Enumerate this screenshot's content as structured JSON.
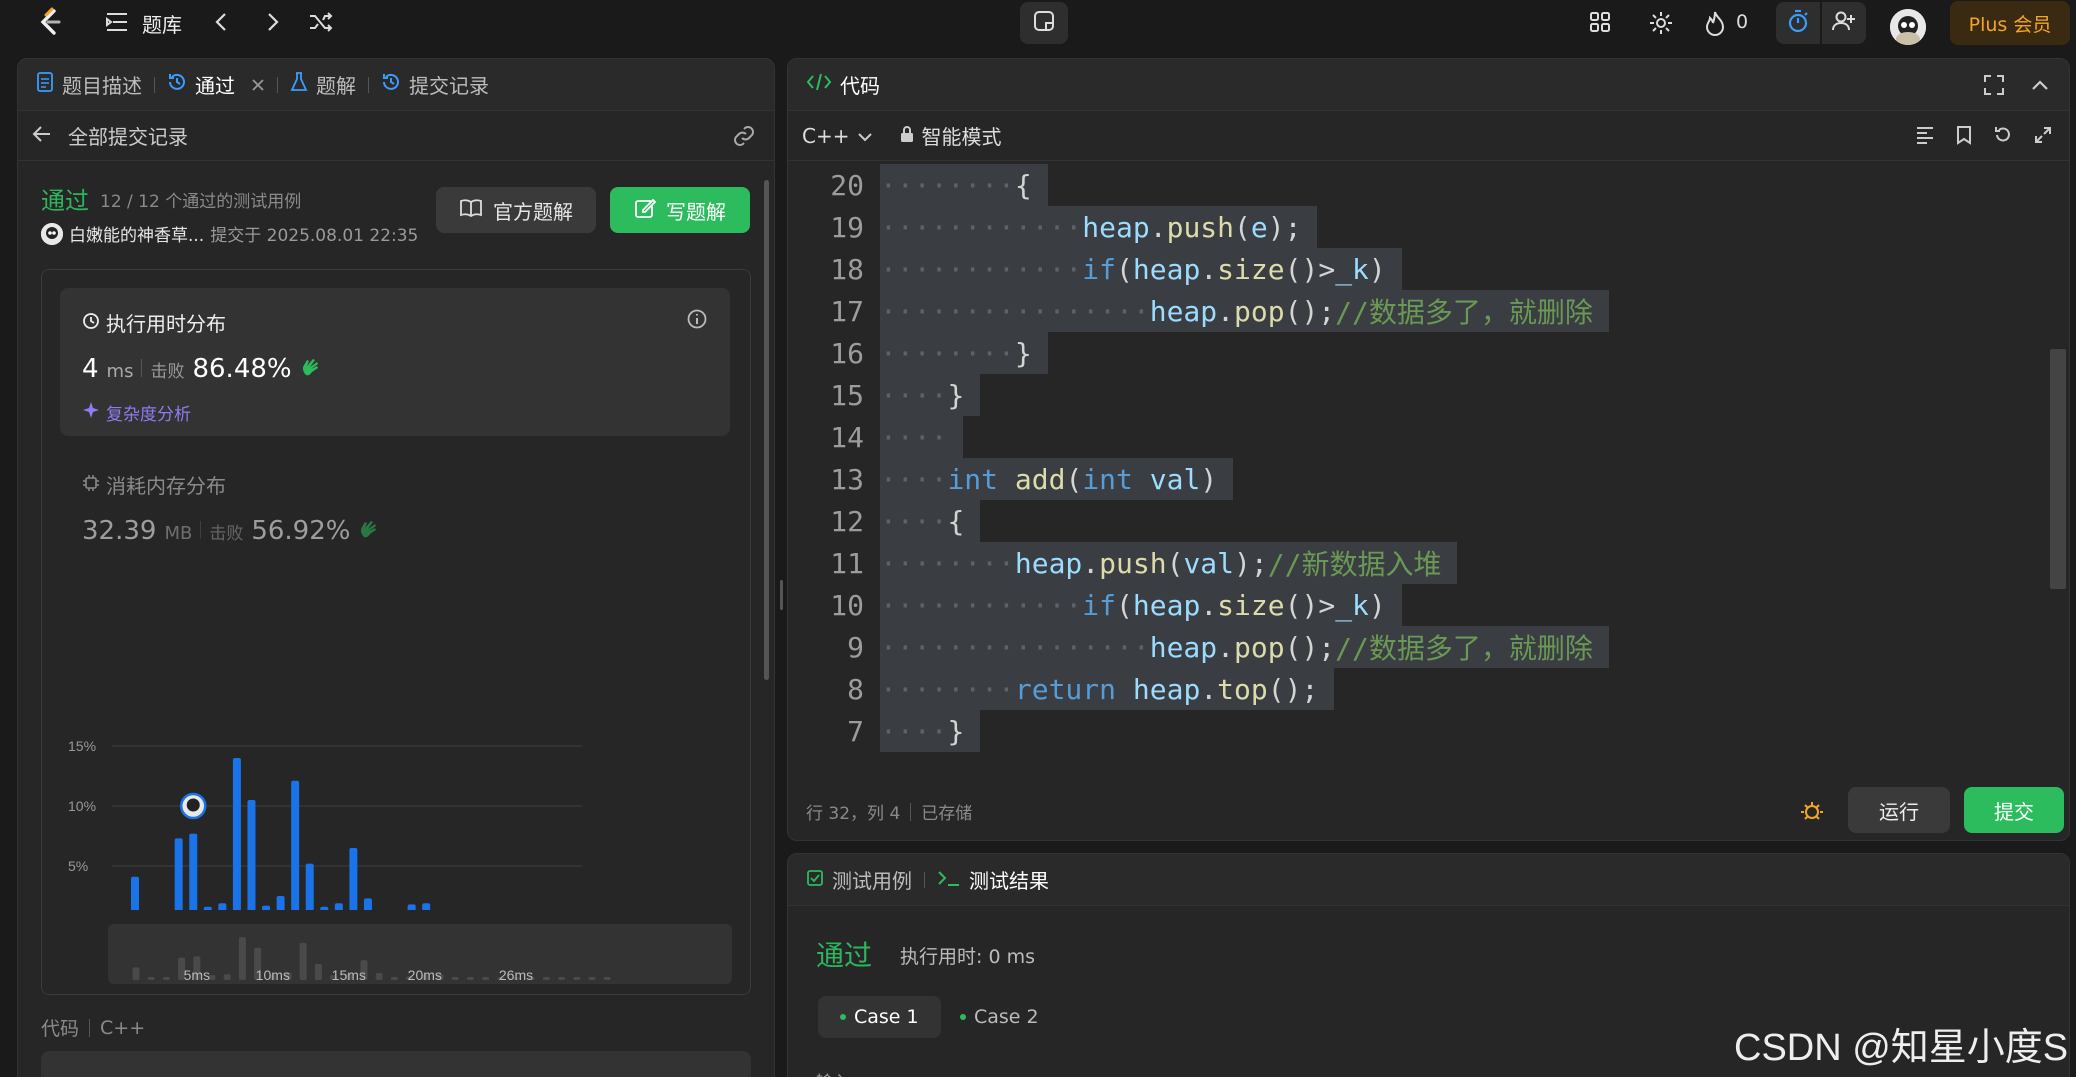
{
  "nav": {
    "title": "题库",
    "fire_count": "0",
    "plus_label": "Plus 会员"
  },
  "left": {
    "tabs": [
      {
        "label": "题目描述"
      },
      {
        "label": "通过"
      },
      {
        "label": "题解"
      },
      {
        "label": "提交记录"
      }
    ],
    "back_label": "全部提交记录",
    "status": "通过",
    "testcases": "12 / 12 个通过的测试用例",
    "user": "白嫩能的神香草...",
    "submitted": "提交于 2025.08.01 22:35",
    "btn_official": "官方题解",
    "btn_write": "写题解",
    "runtime": {
      "title": "执行用时分布",
      "value": "4",
      "unit": "ms",
      "beat_label": "击败",
      "beat_pct": "86.48%",
      "complexity": "复杂度分析"
    },
    "memory": {
      "title": "消耗内存分布",
      "value": "32.39",
      "unit": "MB",
      "beat_label": "击败",
      "beat_pct": "56.92%"
    },
    "code_label": "代码",
    "code_lang": "C++"
  },
  "chart_data": {
    "type": "bar",
    "title": "",
    "xlabel": "",
    "ylabel": "",
    "ylim": [
      0,
      15
    ],
    "y_ticks": [
      "15%",
      "10%",
      "5%",
      "0%"
    ],
    "x_ticks": [
      "5ms",
      "10ms",
      "15ms",
      "20ms",
      "26ms"
    ],
    "values": [
      4.1,
      0.6,
      0.8,
      7.3,
      7.7,
      1.6,
      1.9,
      14.0,
      10.5,
      1.7,
      2.5,
      12.1,
      5.2,
      1.6,
      1.9,
      6.5,
      2.3,
      0.7,
      1.2,
      1.8,
      1.9,
      0.4,
      0.6,
      0.5,
      0.5,
      0.4,
      0.4,
      0.4,
      0.4,
      0.4,
      0.4,
      0.4
    ],
    "highlight_index": 4,
    "mini_x_ticks": [
      "5ms",
      "10ms",
      "15ms",
      "20ms",
      "26ms"
    ]
  },
  "editor": {
    "tab_label": "代码",
    "lang": "C++",
    "mode": "智能模式",
    "lines": [
      {
        "n": "20",
        "indent": 8,
        "tokens": [
          {
            "t": "{",
            "c": "pu"
          }
        ]
      },
      {
        "n": "19",
        "indent": 12,
        "tokens": [
          {
            "t": "heap",
            "c": "vr"
          },
          {
            "t": ".",
            "c": "pu"
          },
          {
            "t": "push",
            "c": "fn"
          },
          {
            "t": "(",
            "c": "pu"
          },
          {
            "t": "e",
            "c": "vr"
          },
          {
            "t": ");",
            "c": "pu"
          }
        ]
      },
      {
        "n": "18",
        "indent": 12,
        "tokens": [
          {
            "t": "if",
            "c": "kw"
          },
          {
            "t": "(",
            "c": "pu"
          },
          {
            "t": "heap",
            "c": "vr"
          },
          {
            "t": ".",
            "c": "pu"
          },
          {
            "t": "size",
            "c": "fn"
          },
          {
            "t": "()>",
            "c": "pu"
          },
          {
            "t": "_k",
            "c": "vr"
          },
          {
            "t": ")",
            "c": "pu"
          }
        ]
      },
      {
        "n": "17",
        "indent": 16,
        "tokens": [
          {
            "t": "heap",
            "c": "vr"
          },
          {
            "t": ".",
            "c": "pu"
          },
          {
            "t": "pop",
            "c": "fn"
          },
          {
            "t": "();",
            "c": "pu"
          },
          {
            "t": "//数据多了，就删除",
            "c": "cm"
          }
        ]
      },
      {
        "n": "16",
        "indent": 8,
        "tokens": [
          {
            "t": "}",
            "c": "pu"
          }
        ]
      },
      {
        "n": "15",
        "indent": 4,
        "tokens": [
          {
            "t": "}",
            "c": "pu"
          }
        ]
      },
      {
        "n": "14",
        "indent": 4,
        "tokens": []
      },
      {
        "n": "13",
        "indent": 4,
        "tokens": [
          {
            "t": "int",
            "c": "kw"
          },
          {
            "t": " ",
            "c": "pu"
          },
          {
            "t": "add",
            "c": "fn"
          },
          {
            "t": "(",
            "c": "pu"
          },
          {
            "t": "int",
            "c": "kw"
          },
          {
            "t": " ",
            "c": "pu"
          },
          {
            "t": "val",
            "c": "vr"
          },
          {
            "t": ")",
            "c": "pu"
          }
        ]
      },
      {
        "n": "12",
        "indent": 4,
        "tokens": [
          {
            "t": "{",
            "c": "pu"
          }
        ]
      },
      {
        "n": "11",
        "indent": 8,
        "tokens": [
          {
            "t": "heap",
            "c": "vr"
          },
          {
            "t": ".",
            "c": "pu"
          },
          {
            "t": "push",
            "c": "fn"
          },
          {
            "t": "(",
            "c": "pu"
          },
          {
            "t": "val",
            "c": "vr"
          },
          {
            "t": ");",
            "c": "pu"
          },
          {
            "t": "//新数据入堆",
            "c": "cm"
          }
        ]
      },
      {
        "n": "10",
        "indent": 12,
        "tokens": [
          {
            "t": "if",
            "c": "kw"
          },
          {
            "t": "(",
            "c": "pu"
          },
          {
            "t": "heap",
            "c": "vr"
          },
          {
            "t": ".",
            "c": "pu"
          },
          {
            "t": "size",
            "c": "fn"
          },
          {
            "t": "()>",
            "c": "pu"
          },
          {
            "t": "_k",
            "c": "vr"
          },
          {
            "t": ")",
            "c": "pu"
          }
        ]
      },
      {
        "n": "9",
        "indent": 16,
        "tokens": [
          {
            "t": "heap",
            "c": "vr"
          },
          {
            "t": ".",
            "c": "pu"
          },
          {
            "t": "pop",
            "c": "fn"
          },
          {
            "t": "();",
            "c": "pu"
          },
          {
            "t": "//数据多了，就删除",
            "c": "cm"
          }
        ]
      },
      {
        "n": "8",
        "indent": 8,
        "tokens": [
          {
            "t": "return",
            "c": "kw"
          },
          {
            "t": " ",
            "c": "pu"
          },
          {
            "t": "heap",
            "c": "vr"
          },
          {
            "t": ".",
            "c": "pu"
          },
          {
            "t": "top",
            "c": "fn"
          },
          {
            "t": "();",
            "c": "pu"
          }
        ]
      },
      {
        "n": "7",
        "indent": 4,
        "tokens": [
          {
            "t": "}",
            "c": "pu"
          }
        ]
      }
    ],
    "status_pos": "行 32，列 4",
    "status_saved": "已存储",
    "run_label": "运行",
    "submit_label": "提交"
  },
  "bottom": {
    "tab_cases": "测试用例",
    "tab_result": "测试结果",
    "result": "通过",
    "time": "执行用时: 0 ms",
    "cases": [
      "Case 1",
      "Case 2"
    ],
    "input_label": "输入"
  },
  "watermark": "CSDN @知星小度S",
  "colors": {
    "accent_green": "#2cbb5d",
    "bar_blue": "#1a73e8",
    "plus_gold": "#f5a524"
  }
}
